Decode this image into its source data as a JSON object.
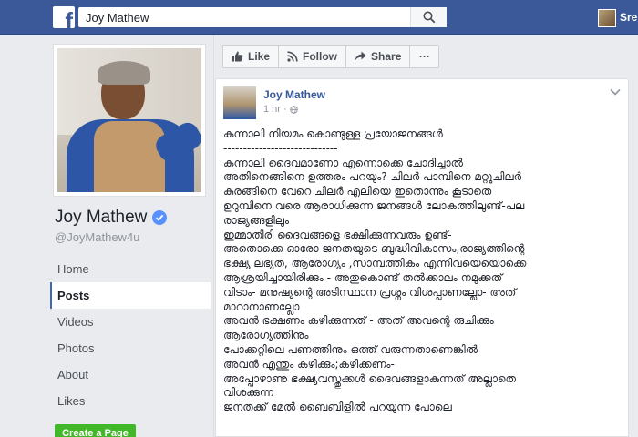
{
  "topbar": {
    "search_value": "Joy Mathew",
    "user_name": "Sre"
  },
  "page": {
    "name": "Joy Mathew",
    "username": "@JoyMathew4u"
  },
  "nav": {
    "items": [
      {
        "label": "Home"
      },
      {
        "label": "Posts",
        "active": true
      },
      {
        "label": "Videos"
      },
      {
        "label": "Photos"
      },
      {
        "label": "About"
      },
      {
        "label": "Likes"
      }
    ],
    "create_page": "Create a Page"
  },
  "actions": {
    "like": "Like",
    "follow": "Follow",
    "share": "Share",
    "more": "···"
  },
  "post": {
    "author": "Joy Mathew",
    "time": "1 hr ·",
    "lines": [
      "കന്നാലി നിയമം കൊണ്ടുള്ള പ്രയോജനങ്ങൾ",
      "-----------------------------",
      "കന്നാലി ദൈവമാണോ എന്നൊക്കെ ചോദിച്ചാൽ",
      "അതിനെങ്ങിനെ ഉത്തരം പറയും? ചിലർ പാമ്പിനെ മറ്റുചിലർ",
      "കുരങ്ങിനെ വേറെ ചിലർ എലിയെ ഇതൊന്നും കൂടാതെ",
      "ഉറുമ്പിനെ വരെ ആരാധിക്കുന്ന ജനങ്ങൾ ലോകത്തിലുണ്ട്-പല",
      "രാജ്യങ്ങളിലും",
      "ഇമ്മാതിരി ദൈവങ്ങളെ ഭക്ഷിക്കുന്നവരും ഉണ്ട്-",
      "അതൊക്കെ ഓരോ ജനതയുടെ ബുദ്ധിവികാസം,രാജ്യത്തിന്റെ",
      "ഭക്ഷ്യ ലഭ്യത, ആരോഗ്യം ,സാമ്പത്തികം എന്നിവയെയൊക്കെ",
      "ആശ്രയിച്ചായിരിക്കും - അതുകൊണ്ട് തൽക്കാലം നമുക്കത്",
      "വിടാം- മനുഷ്യന്റെ അടിസ്ഥാന പ്രശ്നം വിശപ്പാണല്ലോ- അത്",
      "മാറാനാണല്ലോ",
      "അവൻ ഭക്ഷണം കഴിക്കുന്നത് - അത് അവന്റെ രുചിക്കും",
      "ആരോഗ്യത്തിനും",
      "പോക്കറ്റിലെ പണത്തിനും ഒത്ത് വരുന്നതാണെങ്കിൽ",
      "അവൻ എന്തും കഴിക്കും;കഴിക്കണം-",
      "അപ്പോഴാണു ഭക്ഷ്യവസ്തുക്കൾ ദൈവങ്ങളാകുന്നത് അല്ലാതെ",
      "വിശക്കുന്ന",
      "ജനതക്ക് മേൽ ബൈബിളിൽ പറയുന്ന പോലെ"
    ]
  },
  "colors": {
    "brand": "#3b5998",
    "link": "#365899",
    "create_page_green": "#42b72a",
    "verified_blue": "#5890ff"
  },
  "icons": [
    "facebook-logo-icon",
    "search-icon",
    "verified-badge-icon",
    "like-icon",
    "follow-rss-icon",
    "share-icon",
    "globe-icon",
    "chevron-down-icon"
  ]
}
